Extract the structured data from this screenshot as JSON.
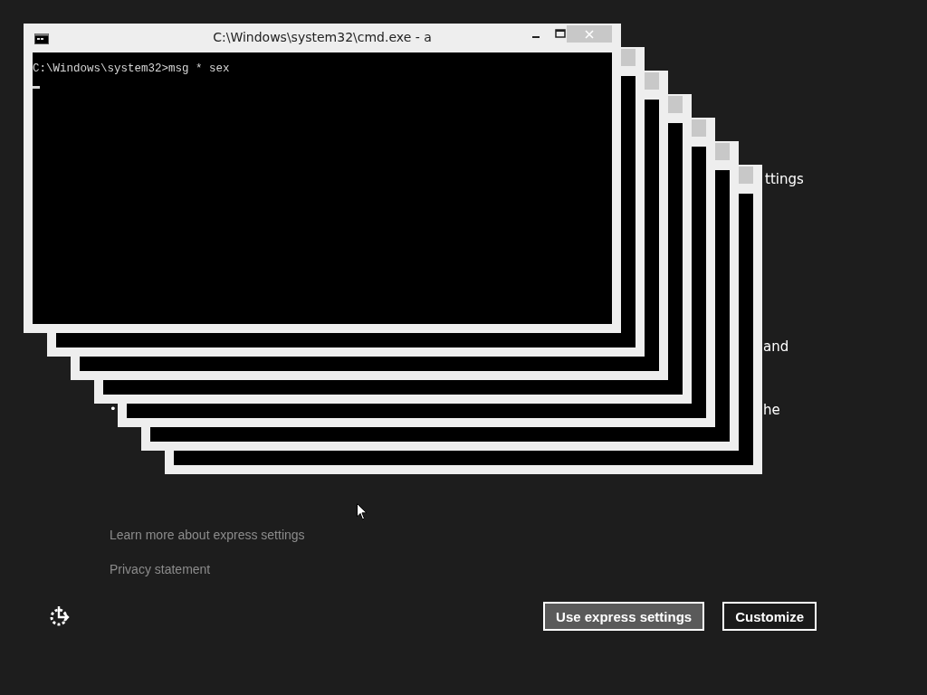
{
  "background_text": [
    {
      "kind": "tail",
      "text": "ttings"
    },
    {
      "kind": "tail",
      "text": "and"
    },
    {
      "kind": "bullet",
      "text": "•"
    },
    {
      "kind": "tail",
      "text": "he"
    }
  ],
  "windows": [
    {
      "kind": "console",
      "title": "C:\\Windows\\system32\\cmd.exe - a",
      "lines": [
        "C:\\Windows\\system32>msg * sex"
      ],
      "cursor": true
    },
    {
      "kind": "console"
    },
    {
      "kind": "console"
    },
    {
      "kind": "console"
    },
    {
      "kind": "console"
    },
    {
      "kind": "console"
    },
    {
      "kind": "console"
    }
  ],
  "links": [
    "Learn more about express settings",
    "Privacy statement"
  ],
  "buttons": [
    {
      "label": "Use express settings",
      "kind": "primary"
    },
    {
      "label": "Customize",
      "kind": "secondary"
    }
  ]
}
